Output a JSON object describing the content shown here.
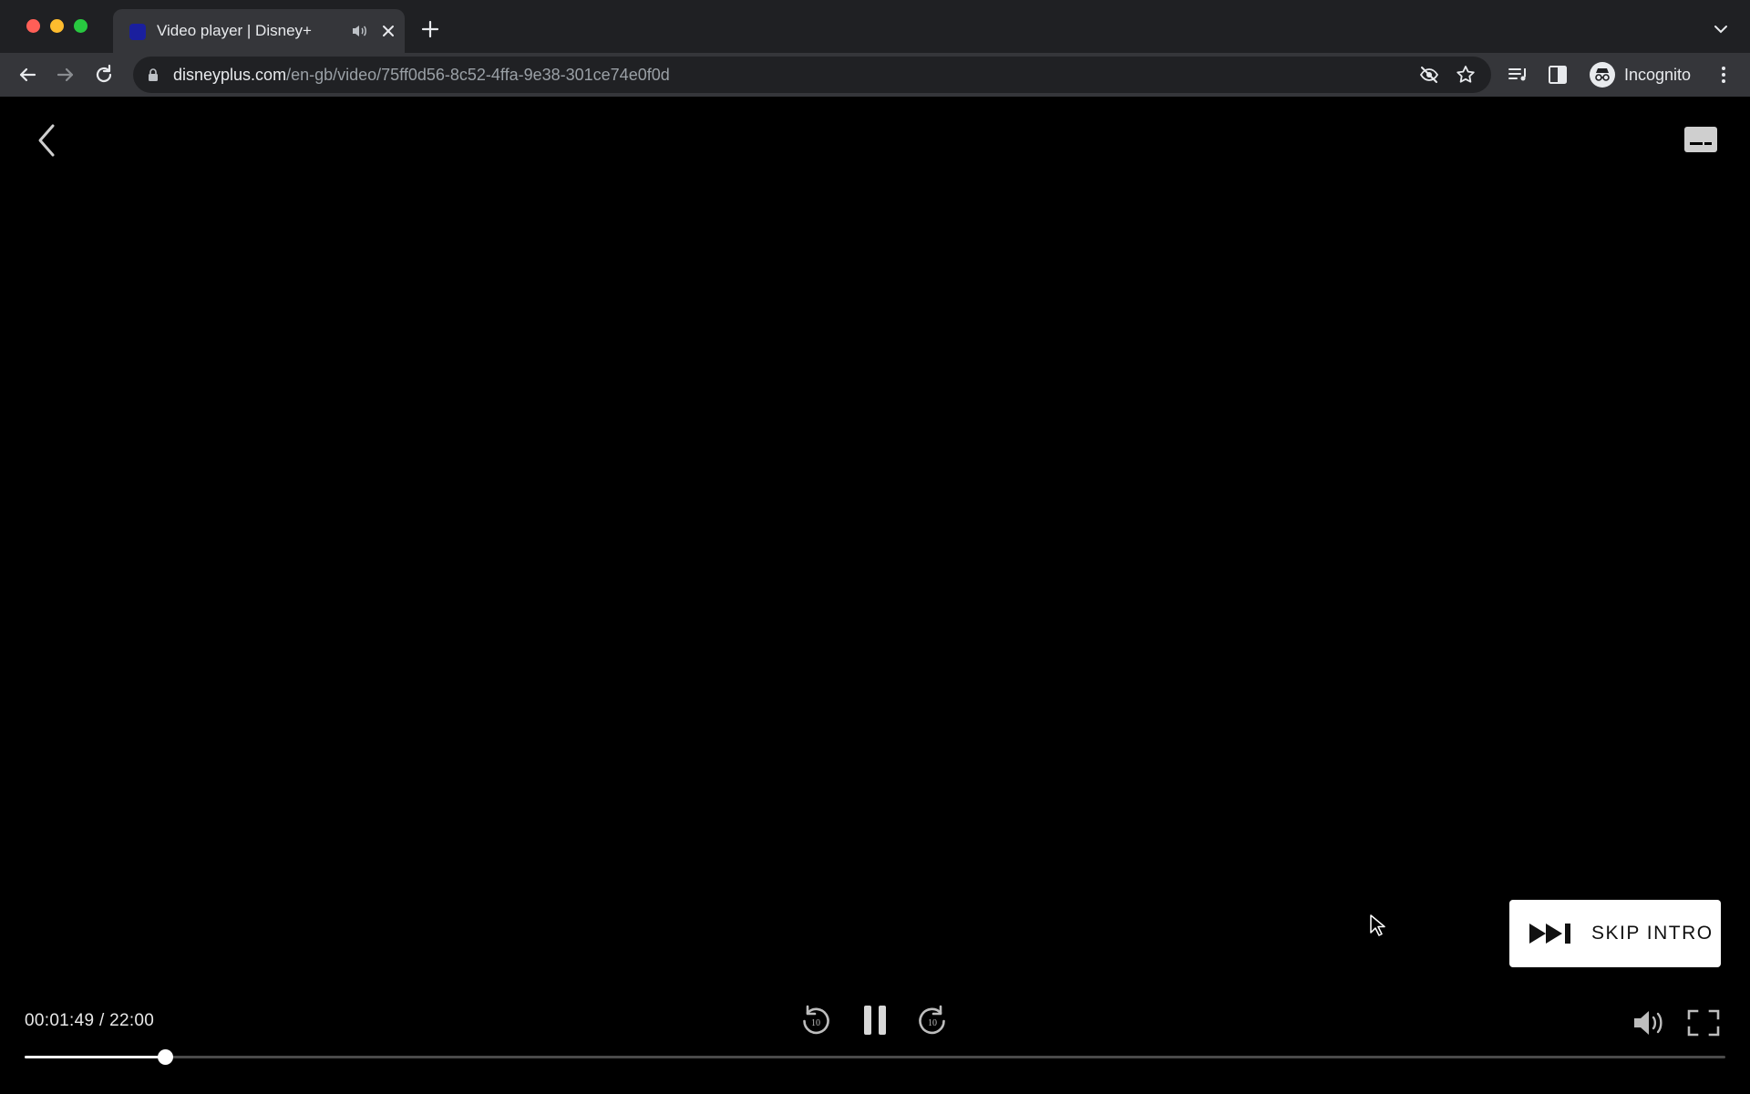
{
  "browser": {
    "tab": {
      "title": "Video player | Disney+"
    },
    "address": {
      "host": "disneyplus.com",
      "path": "/en-gb/video/75ff0d56-8c52-4ffa-9e38-301ce74e0f0d"
    },
    "profile": {
      "label": "Incognito"
    }
  },
  "player": {
    "time": {
      "readout": "00:01:49 / 22:00"
    },
    "skip_intro": {
      "label": "SKIP INTRO"
    },
    "progress": {
      "current_seconds": 109,
      "duration_seconds": 1320
    },
    "rewind": {
      "seconds_label": "10"
    },
    "forward": {
      "seconds_label": "10"
    }
  },
  "icons": {
    "back": "chevron-left-icon",
    "subtitles": "subtitles-icon",
    "rewind": "rewind-10-icon",
    "pause": "pause-icon",
    "forward": "forward-10-icon",
    "volume": "volume-icon",
    "fullscreen": "fullscreen-icon",
    "skip": "skip-forward-icon"
  }
}
